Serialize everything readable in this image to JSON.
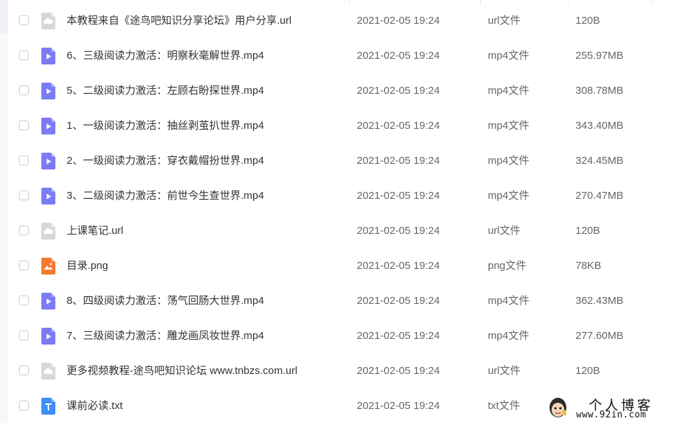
{
  "file_list": {
    "rows": [
      {
        "name": "本教程来自《途鸟吧知识分享论坛》用户分享.url",
        "date": "2021-02-05 19:24",
        "type": "url文件",
        "size": "120B",
        "icon": "cloud-link-icon"
      },
      {
        "name": "6、三级阅读力激活：明察秋毫解世界.mp4",
        "date": "2021-02-05 19:24",
        "type": "mp4文件",
        "size": "255.97MB",
        "icon": "video-icon"
      },
      {
        "name": "5、二级阅读力激活：左顾右盼探世界.mp4",
        "date": "2021-02-05 19:24",
        "type": "mp4文件",
        "size": "308.78MB",
        "icon": "video-icon"
      },
      {
        "name": "1、一级阅读力激活：抽丝剥茧扒世界.mp4",
        "date": "2021-02-05 19:24",
        "type": "mp4文件",
        "size": "343.40MB",
        "icon": "video-icon"
      },
      {
        "name": "2、一级阅读力激活：穿衣戴帽扮世界.mp4",
        "date": "2021-02-05 19:24",
        "type": "mp4文件",
        "size": "324.45MB",
        "icon": "video-icon"
      },
      {
        "name": "3、二级阅读力激活：前世今生查世界.mp4",
        "date": "2021-02-05 19:24",
        "type": "mp4文件",
        "size": "270.47MB",
        "icon": "video-icon"
      },
      {
        "name": "上课笔记.url",
        "date": "2021-02-05 19:24",
        "type": "url文件",
        "size": "120B",
        "icon": "cloud-link-icon"
      },
      {
        "name": "目录.png",
        "date": "2021-02-05 19:24",
        "type": "png文件",
        "size": "78KB",
        "icon": "image-icon"
      },
      {
        "name": "8、四级阅读力激活：荡气回肠大世界.mp4",
        "date": "2021-02-05 19:24",
        "type": "mp4文件",
        "size": "362.43MB",
        "icon": "video-icon"
      },
      {
        "name": "7、三级阅读力激活：雕龙画凤妆世界.mp4",
        "date": "2021-02-05 19:24",
        "type": "mp4文件",
        "size": "277.60MB",
        "icon": "video-icon"
      },
      {
        "name": "更多视频教程-途鸟吧知识论坛 www.tnbzs.com.url",
        "date": "2021-02-05 19:24",
        "type": "url文件",
        "size": "120B",
        "icon": "cloud-link-icon"
      },
      {
        "name": "课前必读.txt",
        "date": "2021-02-05 19:24",
        "type": "txt文件",
        "size": "",
        "icon": "text-doc-icon"
      }
    ]
  },
  "watermark": {
    "title": "个人博客",
    "url": "www.92in.com"
  },
  "colors": {
    "video": "#7b7cf4",
    "cloud": "#d6d8dc",
    "image": "#f5792e",
    "text_doc": "#3d8ef7"
  }
}
